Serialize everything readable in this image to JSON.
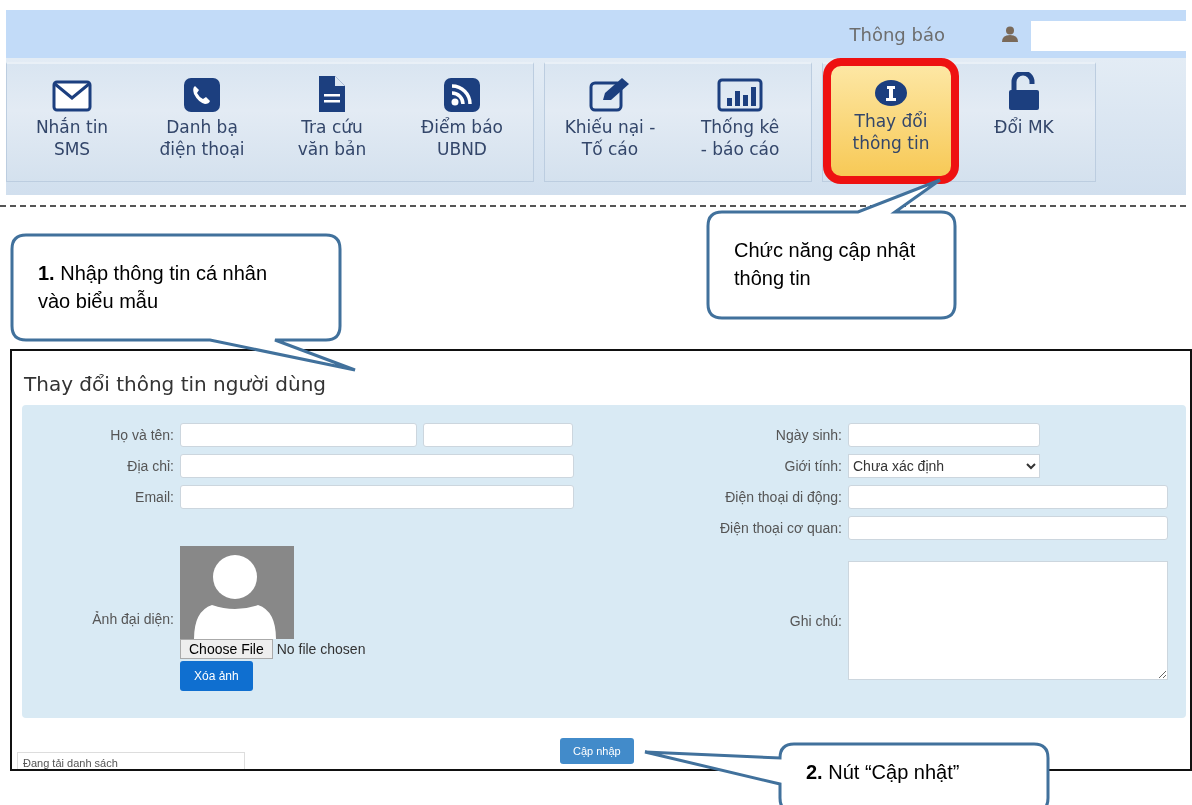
{
  "header": {
    "notice": "Thông báo"
  },
  "ribbon": {
    "groups": [
      {
        "items": [
          {
            "kind": "envelope",
            "label": "Nhắn tin\nSMS",
            "selected": false,
            "highlighted": false
          },
          {
            "kind": "phone",
            "label": "Danh bạ\nđiện thoại",
            "selected": false,
            "highlighted": false
          },
          {
            "kind": "document",
            "label": "Tra cứu\nvăn bản",
            "selected": false,
            "highlighted": false
          },
          {
            "kind": "rss",
            "label": "Điểm báo\nUBND",
            "selected": false,
            "highlighted": false
          }
        ]
      },
      {
        "items": [
          {
            "kind": "edit",
            "label": "Khiếu nại -\nTố cáo",
            "selected": false,
            "highlighted": false
          },
          {
            "kind": "chart",
            "label": "Thống kê\n- báo cáo",
            "selected": false,
            "highlighted": false
          }
        ]
      },
      {
        "items": [
          {
            "kind": "info",
            "label": "Thay đổi\nthông tin",
            "selected": true,
            "highlighted": true
          },
          {
            "kind": "unlock",
            "label": "Đổi MK",
            "selected": false,
            "highlighted": false
          }
        ]
      }
    ]
  },
  "form": {
    "title": "Thay đổi thông tin người dùng",
    "left_fields": [
      {
        "label": "Họ và tên:",
        "kind": "double"
      },
      {
        "label": "Địa chỉ:",
        "kind": "text"
      },
      {
        "label": "Email:",
        "kind": "text"
      }
    ],
    "avatar": {
      "label": "Ảnh đại diện:",
      "choose_button": "Choose File",
      "file_status": "No file chosen",
      "delete_button": "Xóa ảnh"
    },
    "right_fields": [
      {
        "label": "Ngày sinh:",
        "kind": "short"
      },
      {
        "label": "Giới tính:",
        "kind": "select",
        "value": "Chưa xác định"
      },
      {
        "label": "Điện thoại di động:",
        "kind": "text"
      },
      {
        "label": "Điện thoại cơ quan:",
        "kind": "text"
      },
      {
        "label": "Ghi chú:",
        "kind": "textarea"
      }
    ],
    "submit_button": "Cập nhập",
    "loading": "Đang tải danh sách"
  },
  "callouts": [
    {
      "text": "**1.** Nhập thông tin cá nhân vào biểu mẫu"
    },
    {
      "text": "Chức năng cập nhật thông tin"
    },
    {
      "text": "**2.** Nút “Cập nhật”"
    }
  ]
}
